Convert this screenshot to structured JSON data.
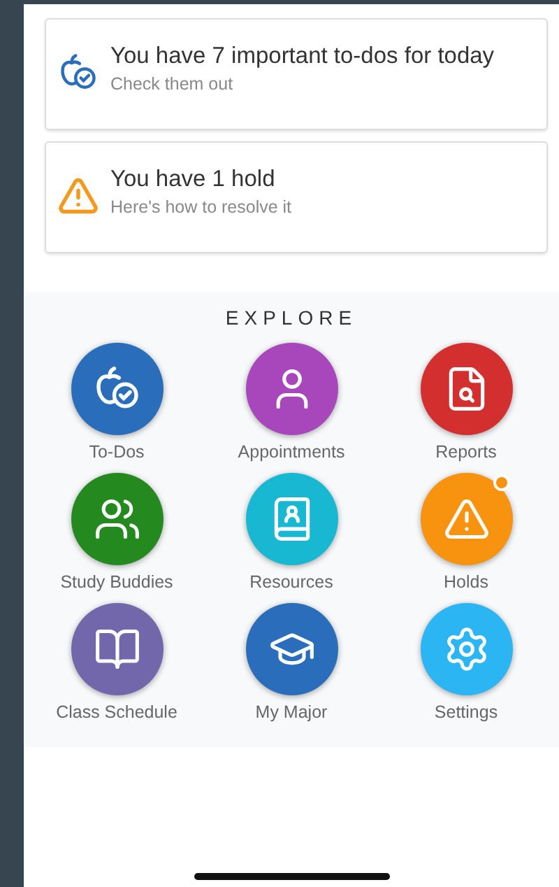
{
  "alerts": [
    {
      "kind": "todo",
      "title": "You have 7 important to-dos for today",
      "subtitle": "Check them out"
    },
    {
      "kind": "hold",
      "title": "You have 1 hold",
      "subtitle": "Here's how to resolve it"
    }
  ],
  "explore": {
    "heading": "EXPLORE",
    "items": [
      {
        "kind": "todos",
        "label": "To-Dos",
        "color": "#2a6ebb",
        "badge": false
      },
      {
        "kind": "appointments",
        "label": "Appointments",
        "color": "#a747bb",
        "badge": false
      },
      {
        "kind": "reports",
        "label": "Reports",
        "color": "#d42f2f",
        "badge": false
      },
      {
        "kind": "buddies",
        "label": "Study Buddies",
        "color": "#24891f",
        "badge": false
      },
      {
        "kind": "resources",
        "label": "Resources",
        "color": "#19b8d2",
        "badge": false
      },
      {
        "kind": "holds",
        "label": "Holds",
        "color": "#f7930f",
        "badge": true
      },
      {
        "kind": "schedule",
        "label": "Class Schedule",
        "color": "#7367ac",
        "badge": false
      },
      {
        "kind": "major",
        "label": "My Major",
        "color": "#2a6ebb",
        "badge": false
      },
      {
        "kind": "settings",
        "label": "Settings",
        "color": "#2cb5f3",
        "badge": false
      }
    ]
  }
}
